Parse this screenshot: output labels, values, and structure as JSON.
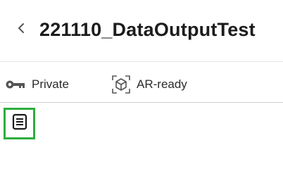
{
  "header": {
    "back_icon": "chevron-left-icon",
    "title": "221110_DataOutputTest"
  },
  "meta": {
    "visibility_icon": "key-icon",
    "visibility_label": "Private",
    "ar_icon": "ar-cube-icon",
    "ar_label": "AR-ready"
  },
  "toolbar": {
    "notes_icon": "document-list-icon",
    "highlight_color": "#2eae3c"
  }
}
